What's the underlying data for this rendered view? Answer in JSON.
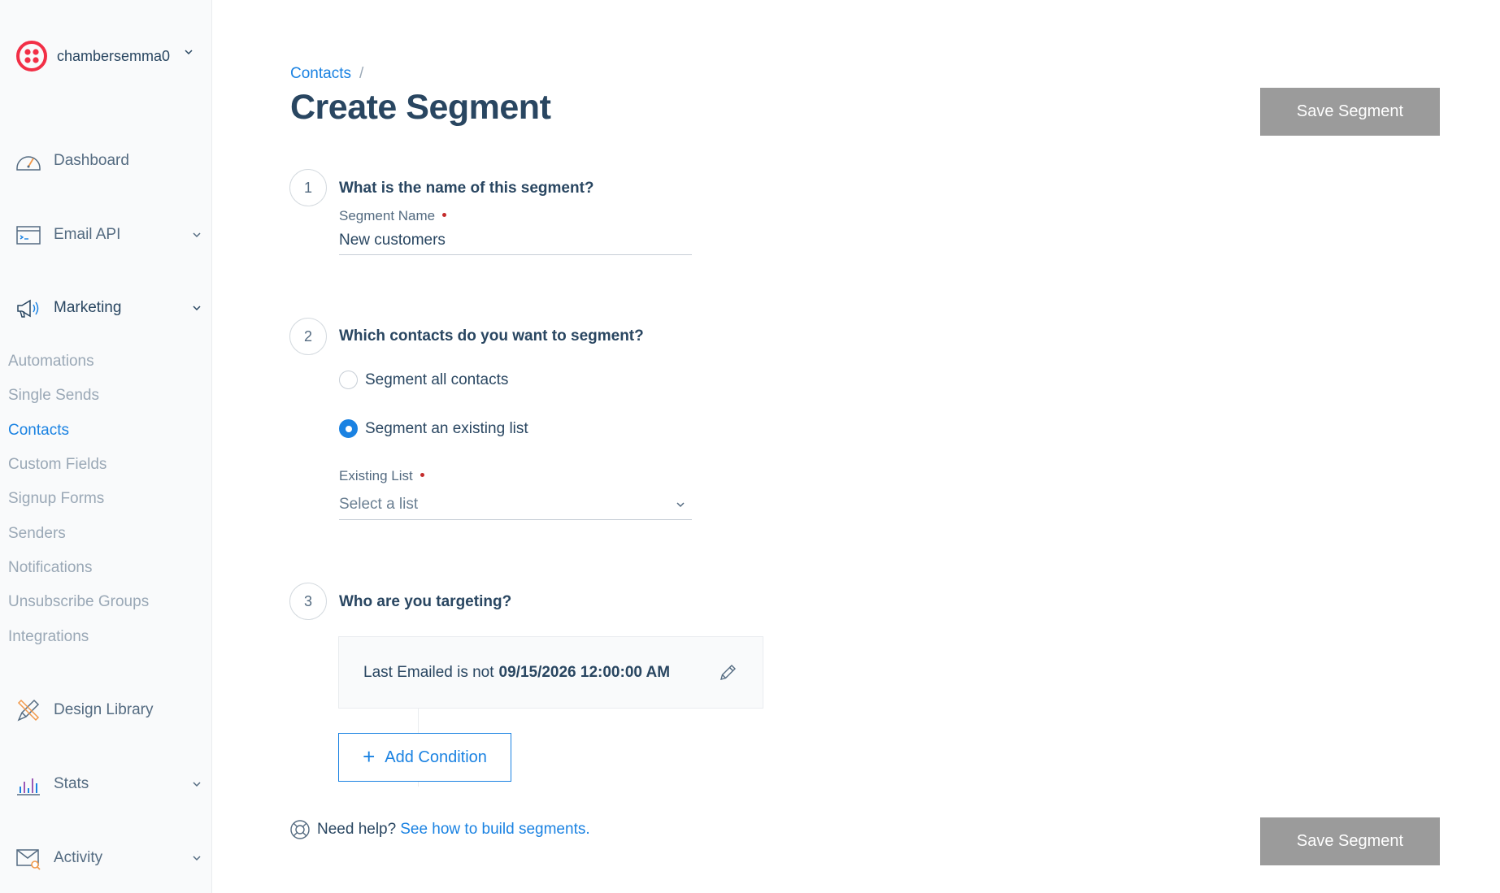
{
  "account": {
    "name": "chambersemma0",
    "icon": "twilio-logo"
  },
  "sidebar": {
    "nav": [
      {
        "label": "Dashboard",
        "icon": "dashboard-gauge-icon"
      },
      {
        "label": "Email API",
        "icon": "email-api-icon"
      },
      {
        "label": "Marketing",
        "icon": "megaphone-icon"
      }
    ],
    "marketing_items": [
      {
        "label": "Automations"
      },
      {
        "label": "Single Sends"
      },
      {
        "label": "Contacts",
        "current": true
      },
      {
        "label": "Custom Fields"
      },
      {
        "label": "Signup Forms"
      },
      {
        "label": "Senders"
      },
      {
        "label": "Notifications"
      },
      {
        "label": "Unsubscribe Groups"
      },
      {
        "label": "Integrations"
      }
    ],
    "nav_bottom": [
      {
        "label": "Design Library",
        "icon": "design-tools-icon"
      },
      {
        "label": "Stats",
        "icon": "stats-bar-chart-icon"
      },
      {
        "label": "Activity",
        "icon": "activity-mail-search-icon"
      }
    ]
  },
  "breadcrumb": {
    "parent": "Contacts",
    "separator": "/"
  },
  "page": {
    "title": "Create Segment",
    "save_label": "Save Segment"
  },
  "steps": [
    {
      "number": "1",
      "question": "What is the name of this segment?",
      "field_label": "Segment Name",
      "field_value": "New customers"
    },
    {
      "number": "2",
      "question": "Which contacts do you want to segment?",
      "options": [
        {
          "label": "Segment all contacts",
          "selected": false
        },
        {
          "label": "Segment an existing list",
          "selected": true
        }
      ],
      "list_label": "Existing List",
      "list_placeholder": "Select a list"
    },
    {
      "number": "3",
      "question": "Who are you targeting?",
      "condition_prefix": "Last Emailed is not",
      "condition_value": "09/15/2026 12:00:00 AM",
      "add_label": "Add Condition"
    }
  ],
  "help": {
    "text": "Need help?",
    "link": "See how to build segments."
  },
  "colors": {
    "accent": "#1a82e2",
    "text": "#294661",
    "muted": "#546b81",
    "disabled_button": "#9b9b9b",
    "required": "#c42c2c",
    "brand": "#f22f46"
  }
}
